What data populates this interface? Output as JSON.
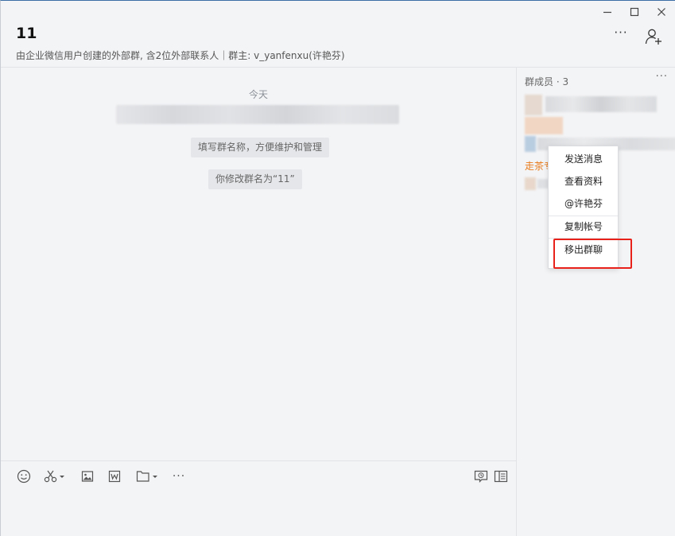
{
  "window": {
    "minimize_glyph": "—",
    "maximize_glyph": "☐",
    "close_glyph": "✕"
  },
  "header": {
    "title": "11",
    "subtitle": "由企业微信用户创建的外部群, 含2位外部联系人｜群主: v_yanfenxu(许艳芬)",
    "more_glyph": "···"
  },
  "chat": {
    "date_divider": "今天",
    "system_messages": [
      "填写群名称，方便维护和管理",
      "你修改群名为“11”"
    ]
  },
  "toolbar": {
    "icons": [
      "emoji-icon",
      "screenshot-scissors-icon",
      "image-icon",
      "word-doc-icon",
      "folder-icon",
      "more-icon",
      "chat-history-icon",
      "sidebar-toggle-icon"
    ],
    "more_glyph": "···"
  },
  "sidebar": {
    "members_label": "群成员 · 3",
    "more_glyph": "···",
    "partial_name": "走茶专"
  },
  "context_menu": {
    "items": [
      {
        "label": "发送消息"
      },
      {
        "label": "查看资料"
      },
      {
        "label": "@许艳芬"
      },
      {
        "label": "复制帐号"
      },
      {
        "label": "移出群聊"
      }
    ]
  },
  "colors": {
    "accent_highlight": "#e8221a",
    "orange_name": "#e87a1a",
    "background": "#f3f4f6"
  }
}
